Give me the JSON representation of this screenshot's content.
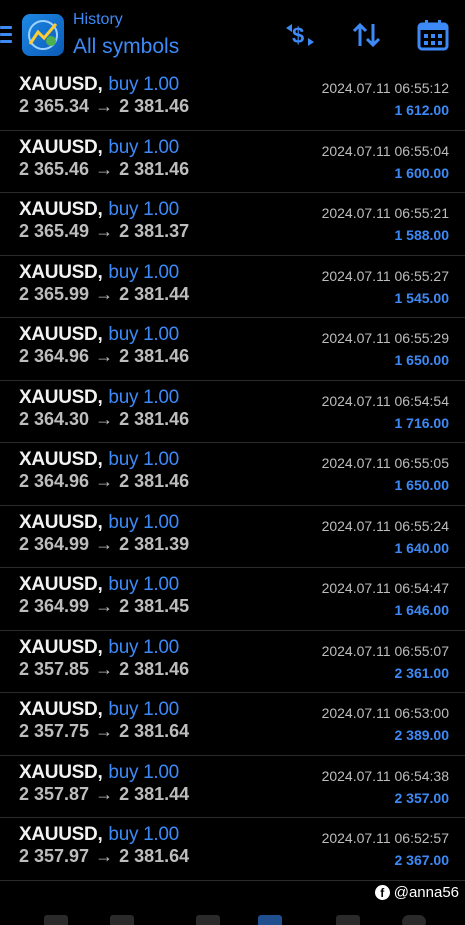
{
  "header": {
    "subtitle": "History",
    "title": "All symbols",
    "accent_color": "#3d8af7",
    "buttons": [
      {
        "icon": "currency-swap-icon"
      },
      {
        "icon": "sort-icon"
      },
      {
        "icon": "calendar-icon"
      }
    ]
  },
  "trades": [
    {
      "symbol": "XAUUSD",
      "side": "buy 1.00",
      "open": "2 365.34",
      "close": "2 381.46",
      "time": "2024.07.11 06:55:12",
      "profit": "1 612.00"
    },
    {
      "symbol": "XAUUSD",
      "side": "buy 1.00",
      "open": "2 365.46",
      "close": "2 381.46",
      "time": "2024.07.11 06:55:04",
      "profit": "1 600.00"
    },
    {
      "symbol": "XAUUSD",
      "side": "buy 1.00",
      "open": "2 365.49",
      "close": "2 381.37",
      "time": "2024.07.11 06:55:21",
      "profit": "1 588.00"
    },
    {
      "symbol": "XAUUSD",
      "side": "buy 1.00",
      "open": "2 365.99",
      "close": "2 381.44",
      "time": "2024.07.11 06:55:27",
      "profit": "1 545.00"
    },
    {
      "symbol": "XAUUSD",
      "side": "buy 1.00",
      "open": "2 364.96",
      "close": "2 381.46",
      "time": "2024.07.11 06:55:29",
      "profit": "1 650.00"
    },
    {
      "symbol": "XAUUSD",
      "side": "buy 1.00",
      "open": "2 364.30",
      "close": "2 381.46",
      "time": "2024.07.11 06:54:54",
      "profit": "1 716.00"
    },
    {
      "symbol": "XAUUSD",
      "side": "buy 1.00",
      "open": "2 364.96",
      "close": "2 381.46",
      "time": "2024.07.11 06:55:05",
      "profit": "1 650.00"
    },
    {
      "symbol": "XAUUSD",
      "side": "buy 1.00",
      "open": "2 364.99",
      "close": "2 381.39",
      "time": "2024.07.11 06:55:24",
      "profit": "1 640.00"
    },
    {
      "symbol": "XAUUSD",
      "side": "buy 1.00",
      "open": "2 364.99",
      "close": "2 381.45",
      "time": "2024.07.11 06:54:47",
      "profit": "1 646.00"
    },
    {
      "symbol": "XAUUSD",
      "side": "buy 1.00",
      "open": "2 357.85",
      "close": "2 381.46",
      "time": "2024.07.11 06:55:07",
      "profit": "2 361.00"
    },
    {
      "symbol": "XAUUSD",
      "side": "buy 1.00",
      "open": "2 357.75",
      "close": "2 381.64",
      "time": "2024.07.11 06:53:00",
      "profit": "2 389.00"
    },
    {
      "symbol": "XAUUSD",
      "side": "buy 1.00",
      "open": "2 357.87",
      "close": "2 381.44",
      "time": "2024.07.11 06:54:38",
      "profit": "2 357.00"
    },
    {
      "symbol": "XAUUSD",
      "side": "buy 1.00",
      "open": "2 357.97",
      "close": "2 381.64",
      "time": "2024.07.11 06:52:57",
      "profit": "2 367.00"
    }
  ],
  "arrow_glyph": "→",
  "watermark": {
    "text": "@anna56",
    "icon": "facebook-icon"
  }
}
